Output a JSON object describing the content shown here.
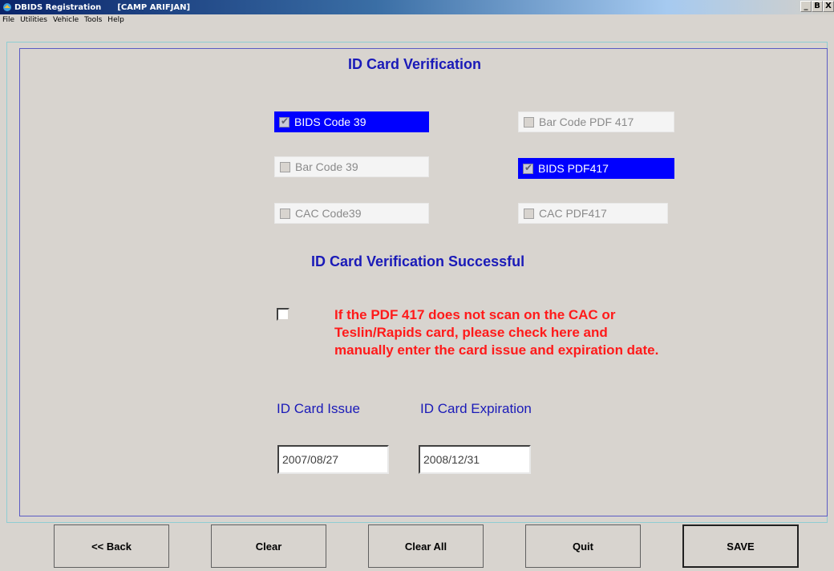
{
  "window": {
    "title": "DBIDS Registration",
    "location": "[CAMP ARIFJAN]",
    "controls": [
      "_",
      "B",
      "X"
    ]
  },
  "menu": [
    "File",
    "Utilities",
    "Vehicle",
    "Tools",
    "Help"
  ],
  "main": {
    "heading": "ID Card Verification",
    "options": [
      {
        "label": "BIDS Code 39",
        "checked": true
      },
      {
        "label": "Bar Code PDF 417",
        "checked": false
      },
      {
        "label": "Bar Code 39",
        "checked": false
      },
      {
        "label": "BIDS PDF417",
        "checked": true
      },
      {
        "label": "CAC Code39",
        "checked": false
      },
      {
        "label": "CAC PDF417",
        "checked": false
      }
    ],
    "status": "ID Card Verification Successful",
    "manual_entry": {
      "checked": false,
      "lines": [
        "If the PDF 417 does not scan on the CAC or",
        "Teslin/Rapids card, please check here and",
        "manually enter the card issue and expiration date."
      ]
    },
    "issue": {
      "label": "ID Card Issue",
      "value": "2007/08/27"
    },
    "expiration": {
      "label": "ID Card Expiration",
      "value": "2008/12/31"
    }
  },
  "buttons": {
    "back": "<< Back",
    "clear": "Clear",
    "clear_all": "Clear All",
    "quit": "Quit",
    "save": "SAVE"
  },
  "colors": {
    "heading": "#1a1ab8",
    "selected": "#0000ff",
    "warning": "#ff1a1a"
  }
}
